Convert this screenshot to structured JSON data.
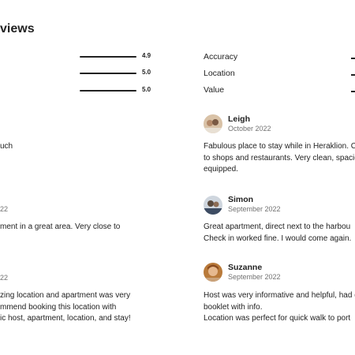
{
  "section": {
    "title_visible": "views"
  },
  "ratings_left": [
    {
      "value": "4.9"
    },
    {
      "value": "5.0"
    },
    {
      "value": "5.0"
    }
  ],
  "categories": [
    {
      "label": "Accuracy"
    },
    {
      "label": "Location"
    },
    {
      "label": "Value"
    }
  ],
  "reviews_right": [
    {
      "name": "Leigh",
      "date": "October 2022",
      "lines": [
        "Fabulous place to stay while in Heraklion. Clo",
        "to shops and restaurants. Very clean, spacio",
        "equipped."
      ]
    },
    {
      "name": "Simon",
      "date": "September 2022",
      "lines": [
        "Great apartment, direct next to the harbou",
        "Check in worked fine. I would come again."
      ]
    },
    {
      "name": "Suzanne",
      "date": "September 2022",
      "lines": [
        "Host was very informative and helpful, had g",
        "booklet with info.",
        "Location was perfect for quick walk to port"
      ]
    }
  ],
  "reviews_left_partial": [
    {
      "lines": [
        "uch"
      ]
    },
    {
      "date": "22",
      "lines": [
        "ment in a great area. Very close to"
      ]
    },
    {
      "date": "22",
      "lines": [
        "zing location and apartment was very",
        "mmend booking this location with",
        "ic host, apartment, location, and stay!"
      ]
    }
  ]
}
